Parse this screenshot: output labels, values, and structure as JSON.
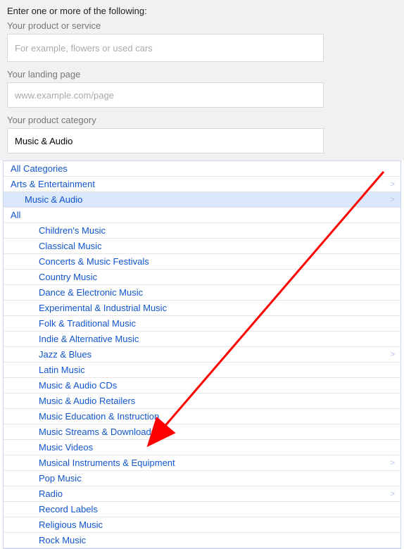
{
  "form": {
    "title": "Enter one or more of the following:",
    "product_label": "Your product or service",
    "product_placeholder": "For example, flowers or used cars",
    "landing_label": "Your landing page",
    "landing_placeholder": "www.example.com/page",
    "category_label": "Your product category",
    "category_value": "Music & Audio"
  },
  "dropdown": {
    "rows": [
      {
        "label": "All Categories",
        "level": 0,
        "selected": false,
        "has_children": false
      },
      {
        "label": "Arts & Entertainment",
        "level": 0,
        "selected": false,
        "has_children": true
      },
      {
        "label": "Music & Audio",
        "level": 1,
        "selected": true,
        "has_children": true
      },
      {
        "label": "All",
        "level": 0,
        "selected": false,
        "has_children": false
      },
      {
        "label": "Children's Music",
        "level": 2,
        "selected": false,
        "has_children": false
      },
      {
        "label": "Classical Music",
        "level": 2,
        "selected": false,
        "has_children": false
      },
      {
        "label": "Concerts & Music Festivals",
        "level": 2,
        "selected": false,
        "has_children": false
      },
      {
        "label": "Country Music",
        "level": 2,
        "selected": false,
        "has_children": false
      },
      {
        "label": "Dance & Electronic Music",
        "level": 2,
        "selected": false,
        "has_children": false
      },
      {
        "label": "Experimental & Industrial Music",
        "level": 2,
        "selected": false,
        "has_children": false
      },
      {
        "label": "Folk & Traditional Music",
        "level": 2,
        "selected": false,
        "has_children": false
      },
      {
        "label": "Indie & Alternative Music",
        "level": 2,
        "selected": false,
        "has_children": false
      },
      {
        "label": "Jazz & Blues",
        "level": 2,
        "selected": false,
        "has_children": true
      },
      {
        "label": "Latin Music",
        "level": 2,
        "selected": false,
        "has_children": false
      },
      {
        "label": "Music & Audio CDs",
        "level": 2,
        "selected": false,
        "has_children": false
      },
      {
        "label": "Music & Audio Retailers",
        "level": 2,
        "selected": false,
        "has_children": false
      },
      {
        "label": "Music Education & Instruction",
        "level": 2,
        "selected": false,
        "has_children": false
      },
      {
        "label": "Music Streams & Downloads",
        "level": 2,
        "selected": false,
        "has_children": false
      },
      {
        "label": "Music Videos",
        "level": 2,
        "selected": false,
        "has_children": false
      },
      {
        "label": "Musical Instruments & Equipment",
        "level": 2,
        "selected": false,
        "has_children": true
      },
      {
        "label": "Pop Music",
        "level": 2,
        "selected": false,
        "has_children": false
      },
      {
        "label": "Radio",
        "level": 2,
        "selected": false,
        "has_children": true
      },
      {
        "label": "Record Labels",
        "level": 2,
        "selected": false,
        "has_children": false
      },
      {
        "label": "Religious Music",
        "level": 2,
        "selected": false,
        "has_children": false
      },
      {
        "label": "Rock Music",
        "level": 2,
        "selected": false,
        "has_children": false
      }
    ]
  }
}
